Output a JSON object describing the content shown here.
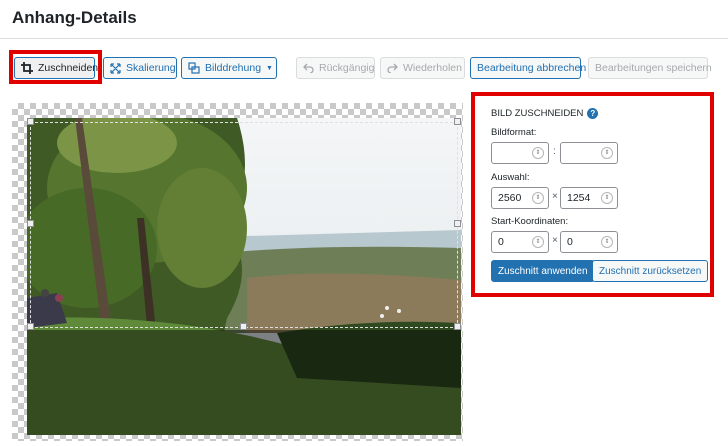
{
  "page": {
    "title": "Anhang-Details"
  },
  "toolbar": {
    "crop_label": "Zuschneiden",
    "scale_label": "Skalierung",
    "rotate_label": "Bilddrehung",
    "undo_label": "Rückgängig",
    "redo_label": "Wiederholen",
    "cancel_label": "Bearbeitung abbrechen",
    "save_label": "Bearbeitungen speichern"
  },
  "crop_panel": {
    "heading": "BILD ZUSCHNEIDEN",
    "help_icon": "?",
    "aspect_label": "Bildformat:",
    "aspect_width": "",
    "aspect_height": "",
    "aspect_separator": ":",
    "selection_label": "Auswahl:",
    "selection_width": "2560",
    "selection_height": "1254",
    "times_separator": "×",
    "start_label": "Start-Koordinaten:",
    "start_x": "0",
    "start_y": "0",
    "apply_label": "Zuschnitt anwenden",
    "reset_label": "Zuschnitt zurücksetzen"
  },
  "colors": {
    "accent": "#2271b1",
    "highlight": "#e10000",
    "disabled": "#a7aaad"
  },
  "icons": {
    "crop": "crop-icon",
    "scale": "scale-arrows-icon",
    "rotate": "rotate-icon",
    "undo": "undo-icon",
    "redo": "redo-icon",
    "help": "help-circle-icon",
    "spinner": "spinner-arrows-icon"
  }
}
